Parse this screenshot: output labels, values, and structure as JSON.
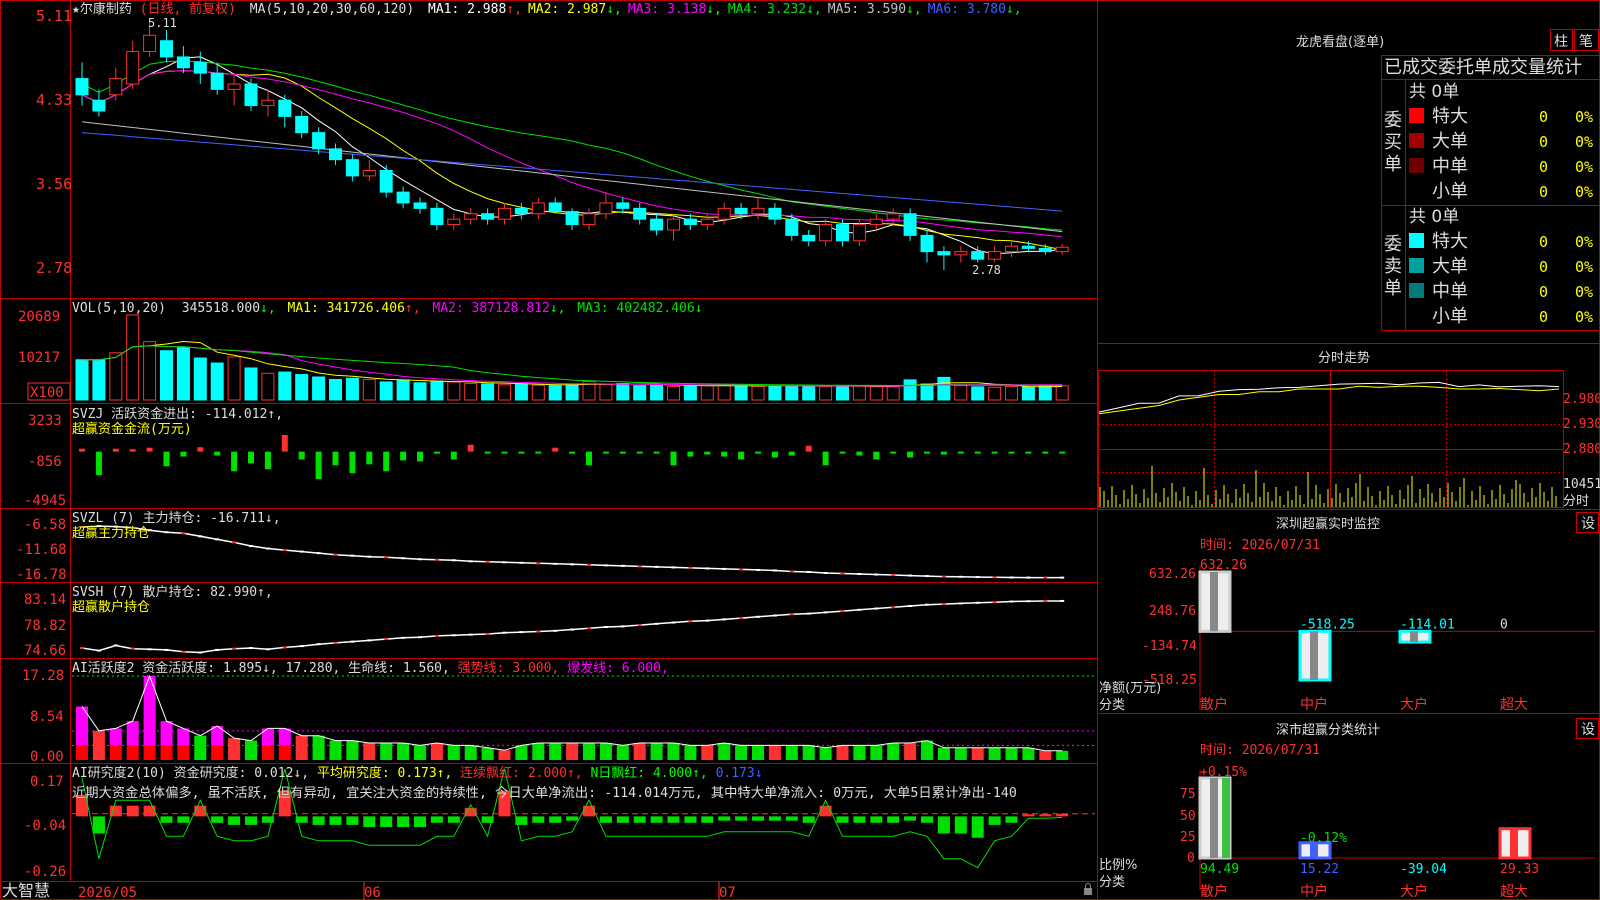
{
  "app": {
    "brand": "大智慧"
  },
  "stock": {
    "name": "★尔康制药",
    "mode": "(日线, 前复权)",
    "ma_label": "MA(5,10,20,30,60,120)",
    "ma_values": [
      {
        "label": "MA1:",
        "value": "2.988",
        "arrow": "↑",
        "color": "#ffffff"
      },
      {
        "label": "MA2:",
        "value": "2.987",
        "arrow": "↓",
        "color": "#ffff00"
      },
      {
        "label": "MA3:",
        "value": "3.138",
        "arrow": "↓",
        "color": "#ff00ff"
      },
      {
        "label": "MA4:",
        "value": "3.232",
        "arrow": "↓",
        "color": "#00e000"
      },
      {
        "label": "MA5:",
        "value": "3.590",
        "arrow": "↓",
        "color": "#c0c0c0"
      },
      {
        "label": "MA6:",
        "value": "3.780",
        "arrow": "↓",
        "color": "#4060ff"
      }
    ],
    "y_ticks": [
      "5.11",
      "4.33",
      "3.56",
      "2.78"
    ],
    "high_label": "5.11",
    "low_label": "2.78"
  },
  "vol": {
    "label": "VOL(5,10,20)",
    "value": "345518.000",
    "ma1": "MA1: 341726.406",
    "ma2": "MA2: 387128.812",
    "ma3": "MA3: 402482.406",
    "y_ticks": [
      "20689",
      "10217"
    ],
    "unit": "X100"
  },
  "svzj": {
    "label": "SVZJ 活跃资金进出: -114.012↑,",
    "sub": "超赢资金金流(万元)",
    "y_ticks": [
      "3233",
      "-856",
      "-4945"
    ]
  },
  "svzl": {
    "label": "SVZL (7) 主力持仓: -16.711↓,",
    "sub": "超赢主力持仓",
    "y_ticks": [
      "-6.58",
      "-11.68",
      "-16.78"
    ]
  },
  "svsh": {
    "label": "SVSH (7) 散户持仓: 82.990↑,",
    "sub": "超赢散户持仓",
    "y_ticks": [
      "83.14",
      "78.82",
      "74.66"
    ]
  },
  "ai1": {
    "label": "AI活跃度2 资金活跃度: 1.895↓, 17.280, 生命线: 1.560,",
    "strong": "强势线: 3.000,",
    "burst": "爆发线: 6.000,",
    "y_ticks": [
      "17.28",
      "8.54",
      "0.00"
    ]
  },
  "ai2": {
    "label": "AI研究度2(10) 资金研究度: 0.012↓,",
    "avg": "平均研究度: 0.173↑,",
    "streak": "连续飘红: 2.000↑,",
    "nred": "N日飘红: 4.000↑,",
    "last": "0.173↓",
    "note": "近期大资金总体偏多, 虽不活跃, 但有异动, 宜关注大资金的持续性, 今日大单净流出: -114.014万元, 其中特大单净流入: 0万元, 大单5日累计净出-140",
    "y_ticks": [
      "0.17",
      "-0.04",
      "-0.26"
    ]
  },
  "xaxis": {
    "labels": [
      "2026/05",
      "06",
      "07"
    ]
  },
  "dragon": {
    "title": "龙虎看盘(逐单)",
    "btn1": "柱",
    "btn2": "笔",
    "subtitle": "已成交委托单成交量统计",
    "buy_side": "委买单",
    "sell_side": "委卖单",
    "buy_total": "共 0单",
    "sell_total": "共 0单",
    "buy_rows": [
      {
        "name": "特大",
        "n": "0",
        "pct": "0%",
        "color": "#ff0000"
      },
      {
        "name": "大单",
        "n": "0",
        "pct": "0%",
        "color": "#a00000"
      },
      {
        "name": "中单",
        "n": "0",
        "pct": "0%",
        "color": "#700000"
      },
      {
        "name": "小单",
        "n": "0",
        "pct": "0%",
        "color": ""
      }
    ],
    "sell_rows": [
      {
        "name": "特大",
        "n": "0",
        "pct": "0%",
        "color": "#00ffff"
      },
      {
        "name": "大单",
        "n": "0",
        "pct": "0%",
        "color": "#00a0a0"
      },
      {
        "name": "中单",
        "n": "0",
        "pct": "0%",
        "color": "#007a7a"
      },
      {
        "name": "小单",
        "n": "0",
        "pct": "0%",
        "color": ""
      }
    ]
  },
  "minute": {
    "title": "分时走势",
    "y_ticks": [
      "2.980",
      "2.930",
      "2.880"
    ],
    "vol_tick": "10451",
    "vol_label": "分时"
  },
  "sz_monitor": {
    "title": "深圳超赢实时监控",
    "btn": "设",
    "date": "时间: 2026/07/31",
    "y_ticks": [
      "632.26",
      "248.76",
      "-134.74",
      "-518.25"
    ],
    "y_label": "净额(万元)",
    "x_label": "分类",
    "values": [
      "632.26",
      "-518.25",
      "-114.01",
      "0"
    ],
    "categories": [
      "散户",
      "中户",
      "大户",
      "超大"
    ]
  },
  "sz_class": {
    "title": "深市超赢分类统计",
    "btn": "设",
    "date": "时间: 2026/07/31",
    "top_label": "+0.15%",
    "mid_label": "-0.12%",
    "y_ticks": [
      "75",
      "50",
      "25",
      "0"
    ],
    "y_label": "比例%",
    "x_label": "分类",
    "values": [
      "94.49",
      "15.22",
      "-39.04",
      "29.33"
    ],
    "categories": [
      "散户",
      "中户",
      "大户",
      "超大"
    ]
  },
  "chart_data": [
    {
      "type": "candlestick",
      "title": "★尔康制药 (日线, 前复权)",
      "ylim": [
        2.78,
        5.11
      ],
      "x_labels": [
        "2026/05",
        "06",
        "07"
      ],
      "candles": [
        [
          4.55,
          4.4,
          4.7,
          4.3
        ],
        [
          4.35,
          4.25,
          4.45,
          4.2
        ],
        [
          4.4,
          4.55,
          4.65,
          4.35
        ],
        [
          4.5,
          4.8,
          4.9,
          4.45
        ],
        [
          4.8,
          4.95,
          5.11,
          4.75
        ],
        [
          4.9,
          4.75,
          5.0,
          4.7
        ],
        [
          4.75,
          4.65,
          4.85,
          4.6
        ],
        [
          4.7,
          4.6,
          4.8,
          4.5
        ],
        [
          4.6,
          4.45,
          4.7,
          4.4
        ],
        [
          4.45,
          4.5,
          4.6,
          4.3
        ],
        [
          4.5,
          4.3,
          4.55,
          4.25
        ],
        [
          4.3,
          4.35,
          4.45,
          4.2
        ],
        [
          4.35,
          4.2,
          4.4,
          4.1
        ],
        [
          4.2,
          4.05,
          4.25,
          4.0
        ],
        [
          4.05,
          3.9,
          4.1,
          3.85
        ],
        [
          3.9,
          3.8,
          3.95,
          3.75
        ],
        [
          3.8,
          3.65,
          3.85,
          3.6
        ],
        [
          3.65,
          3.7,
          3.8,
          3.6
        ],
        [
          3.7,
          3.5,
          3.75,
          3.45
        ],
        [
          3.5,
          3.4,
          3.55,
          3.35
        ],
        [
          3.4,
          3.35,
          3.45,
          3.3
        ],
        [
          3.35,
          3.2,
          3.4,
          3.15
        ],
        [
          3.2,
          3.25,
          3.3,
          3.15
        ],
        [
          3.25,
          3.3,
          3.35,
          3.2
        ],
        [
          3.3,
          3.25,
          3.35,
          3.2
        ],
        [
          3.25,
          3.35,
          3.4,
          3.2
        ],
        [
          3.35,
          3.3,
          3.4,
          3.25
        ],
        [
          3.3,
          3.4,
          3.45,
          3.25
        ],
        [
          3.4,
          3.32,
          3.45,
          3.3
        ],
        [
          3.32,
          3.2,
          3.35,
          3.15
        ],
        [
          3.2,
          3.3,
          3.35,
          3.15
        ],
        [
          3.3,
          3.4,
          3.5,
          3.25
        ],
        [
          3.4,
          3.35,
          3.45,
          3.3
        ],
        [
          3.35,
          3.25,
          3.4,
          3.2
        ],
        [
          3.25,
          3.15,
          3.3,
          3.1
        ],
        [
          3.15,
          3.25,
          3.3,
          3.05
        ],
        [
          3.25,
          3.2,
          3.3,
          3.15
        ],
        [
          3.2,
          3.25,
          3.3,
          3.15
        ],
        [
          3.25,
          3.35,
          3.4,
          3.2
        ],
        [
          3.35,
          3.3,
          3.4,
          3.25
        ],
        [
          3.3,
          3.35,
          3.45,
          3.25
        ],
        [
          3.35,
          3.25,
          3.4,
          3.2
        ],
        [
          3.25,
          3.1,
          3.3,
          3.05
        ],
        [
          3.1,
          3.05,
          3.15,
          3.0
        ],
        [
          3.05,
          3.2,
          3.25,
          3.0
        ],
        [
          3.2,
          3.05,
          3.25,
          3.0
        ],
        [
          3.05,
          3.2,
          3.25,
          3.0
        ],
        [
          3.2,
          3.25,
          3.3,
          3.15
        ],
        [
          3.25,
          3.3,
          3.35,
          3.2
        ],
        [
          3.3,
          3.1,
          3.35,
          3.05
        ],
        [
          3.1,
          2.95,
          3.15,
          2.85
        ],
        [
          2.95,
          2.92,
          3.0,
          2.78
        ],
        [
          2.92,
          2.95,
          3.0,
          2.85
        ],
        [
          2.95,
          2.88,
          3.0,
          2.85
        ],
        [
          2.88,
          2.95,
          3.0,
          2.85
        ],
        [
          2.95,
          3.0,
          3.05,
          2.9
        ],
        [
          3.0,
          2.98,
          3.05,
          2.95
        ],
        [
          2.98,
          2.95,
          3.02,
          2.92
        ],
        [
          2.95,
          2.99,
          3.02,
          2.92
        ]
      ],
      "ma_series": [
        "MA1",
        "MA2",
        "MA3",
        "MA4",
        "MA5",
        "MA6"
      ]
    },
    {
      "type": "bar",
      "title": "VOL(5,10,20)",
      "unit": "X100",
      "values": [
        9800,
        9800,
        11500,
        20689,
        14200,
        12000,
        12800,
        10217,
        9000,
        10500,
        7800,
        6500,
        6800,
        6200,
        5600,
        5000,
        5300,
        5000,
        4400,
        4800,
        4200,
        4600,
        4400,
        4000,
        3900,
        3700,
        3900,
        3600,
        3500,
        3700,
        4500,
        3800,
        4000,
        3500,
        3600,
        3300,
        3400,
        3500,
        3700,
        3400,
        3300,
        3500,
        3600,
        3400,
        3300,
        3200,
        3400,
        3300,
        3200,
        4900,
        3900,
        5500,
        3500,
        3200,
        3100,
        3300,
        3200,
        3400,
        3455
      ],
      "ylim": [
        0,
        20689
      ]
    },
    {
      "type": "bar",
      "title": "SVZJ 活跃资金进出",
      "values": [
        300,
        -2400,
        300,
        250,
        400,
        -1500,
        -500,
        450,
        -400,
        -2000,
        -1200,
        -1800,
        1700,
        -800,
        -2800,
        -1400,
        -2200,
        -1300,
        -2000,
        -900,
        -1000,
        -200,
        -800,
        700,
        -100,
        -100,
        -100,
        -100,
        400,
        -200,
        -1400,
        -200,
        -100,
        -100,
        -100,
        -1400,
        -500,
        -300,
        -500,
        -800,
        -100,
        -600,
        -400,
        600,
        -1400,
        -200,
        -400,
        -800,
        -200,
        -600,
        -200,
        -300,
        -200,
        -100,
        -200,
        -100,
        -100,
        -114,
        -114
      ],
      "ylim": [
        -4945,
        3233
      ]
    },
    {
      "type": "line",
      "title": "SVZL (7) 主力持仓",
      "values": [
        -6.8,
        -6.6,
        -6.7,
        -6.9,
        -7.4,
        -7.8,
        -8.0,
        -8.6,
        -9.2,
        -9.8,
        -10.5,
        -11.0,
        -11.3,
        -11.6,
        -11.9,
        -12.2,
        -12.4,
        -12.6,
        -12.7,
        -12.9,
        -13.1,
        -13.2,
        -13.3,
        -13.5,
        -13.6,
        -13.7,
        -13.8,
        -13.9,
        -14.0,
        -14.1,
        -14.2,
        -14.3,
        -14.4,
        -14.5,
        -14.6,
        -14.7,
        -14.8,
        -14.9,
        -15.0,
        -15.1,
        -15.2,
        -15.3,
        -15.5,
        -15.6,
        -15.8,
        -15.9,
        -16.0,
        -16.1,
        -16.2,
        -16.3,
        -16.4,
        -16.5,
        -16.55,
        -16.6,
        -16.65,
        -16.68,
        -16.7,
        -16.71,
        -16.71
      ],
      "ylim": [
        -16.78,
        -6.58
      ]
    },
    {
      "type": "line",
      "title": "SVSH (7) 散户持仓",
      "values": [
        75.6,
        75.2,
        76.0,
        75.5,
        75.4,
        75.3,
        75.0,
        74.9,
        75.3,
        75.5,
        75.6,
        75.4,
        75.7,
        75.9,
        76.2,
        76.4,
        76.6,
        76.8,
        77.0,
        77.2,
        77.3,
        77.5,
        77.6,
        77.7,
        77.8,
        78.0,
        78.1,
        78.2,
        78.3,
        78.5,
        78.7,
        78.9,
        79.0,
        79.2,
        79.4,
        79.6,
        79.8,
        79.9,
        80.1,
        80.3,
        80.5,
        80.7,
        80.9,
        81.0,
        81.2,
        81.4,
        81.6,
        81.8,
        82.0,
        82.2,
        82.4,
        82.5,
        82.6,
        82.7,
        82.8,
        82.9,
        82.95,
        82.98,
        82.99
      ],
      "ylim": [
        74.66,
        83.14
      ]
    },
    {
      "type": "bar",
      "title": "AI活跃度2",
      "values": [
        11,
        6,
        6.5,
        8,
        17.28,
        8,
        6.5,
        5,
        7,
        4.5,
        4,
        6.5,
        6.5,
        5,
        5,
        4,
        4,
        3.5,
        3.5,
        3.5,
        3,
        3.5,
        3,
        3,
        2.5,
        2,
        3,
        3.5,
        3.5,
        3.5,
        3.5,
        3.5,
        3,
        3.5,
        3.5,
        3.5,
        3,
        3,
        3.5,
        3,
        3,
        3,
        3,
        3,
        2.5,
        3,
        3,
        3,
        3.5,
        3.5,
        4,
        2.5,
        2.5,
        2.5,
        2.5,
        2.5,
        2.5,
        1.9,
        1.9
      ],
      "ylim": [
        0,
        17.28
      ]
    },
    {
      "type": "bar",
      "title": "AI研究度2(10)",
      "values": [
        0.1,
        -0.08,
        0.05,
        0.05,
        0.05,
        -0.03,
        -0.03,
        0.05,
        -0.03,
        -0.04,
        -0.04,
        -0.03,
        0.12,
        -0.03,
        -0.04,
        -0.04,
        -0.04,
        -0.05,
        -0.05,
        -0.05,
        -0.05,
        -0.03,
        -0.03,
        0.04,
        -0.03,
        0.12,
        -0.04,
        -0.03,
        -0.03,
        -0.02,
        0.05,
        -0.03,
        -0.03,
        -0.03,
        -0.03,
        -0.03,
        -0.03,
        -0.03,
        -0.02,
        -0.02,
        -0.02,
        -0.02,
        -0.02,
        -0.03,
        0.05,
        -0.03,
        -0.03,
        -0.03,
        -0.03,
        -0.02,
        -0.03,
        -0.08,
        -0.08,
        -0.1,
        -0.04,
        -0.03,
        0.01,
        0.01,
        0.012
      ],
      "ylim": [
        -0.26,
        0.17
      ]
    },
    {
      "type": "line",
      "title": "分时走势",
      "values": [
        2.93,
        2.935,
        2.94,
        2.945,
        2.955,
        2.96,
        2.965,
        2.965,
        2.97,
        2.97,
        2.975,
        2.975,
        2.975,
        2.98,
        2.978,
        2.98,
        2.98,
        2.978,
        2.975,
        2.975,
        2.976,
        2.974,
        2.972,
        2.975
      ],
      "ylim": [
        2.86,
        3.0
      ]
    },
    {
      "type": "bar",
      "title": "深圳超赢实时监控",
      "categories": [
        "散户",
        "中户",
        "大户",
        "超大"
      ],
      "values": [
        632.26,
        -518.25,
        -114.01,
        0
      ],
      "ylim": [
        -518.25,
        632.26
      ]
    },
    {
      "type": "bar",
      "title": "深市超赢分类统计",
      "categories": [
        "散户",
        "中户",
        "大户",
        "超大"
      ],
      "values": [
        94.49,
        15.22,
        -39.04,
        29.33
      ],
      "ylim": [
        0,
        75
      ]
    }
  ]
}
